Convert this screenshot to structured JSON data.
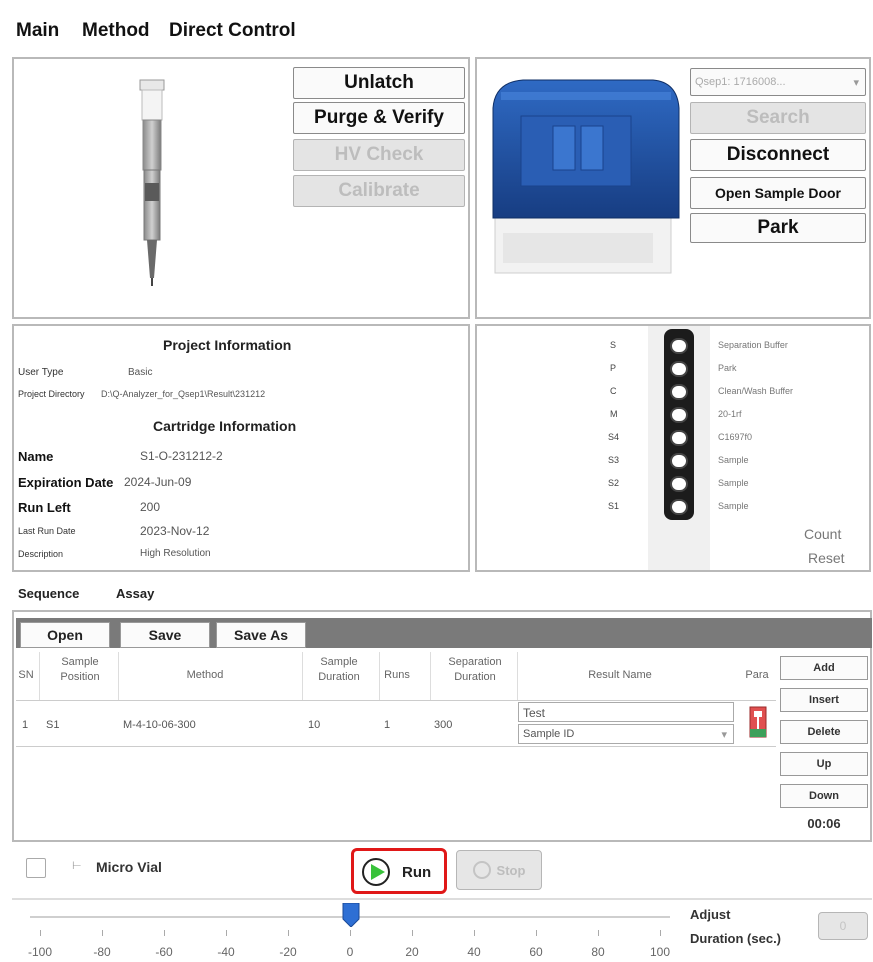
{
  "tabs": {
    "main": "Main",
    "method": "Method",
    "direct_control": "Direct Control"
  },
  "cartridge_controls": {
    "unlatch": "Unlatch",
    "purge_verify": "Purge & Verify",
    "hv_check": "HV Check",
    "calibrate": "Calibrate"
  },
  "instrument_controls": {
    "device_select": "Qsep1: 1716008...",
    "search": "Search",
    "disconnect": "Disconnect",
    "open_sample_door": "Open Sample Door",
    "park": "Park"
  },
  "project_info": {
    "title": "Project Information",
    "user_type_label": "User Type",
    "user_type_value": "Basic",
    "project_directory_label": "Project Directory",
    "project_directory_value": "D:\\Q-Analyzer_for_Qsep1\\Result\\231212"
  },
  "cartridge_info": {
    "title": "Cartridge Information",
    "name_label": "Name",
    "name_value": "S1-O-231212-2",
    "expiration_label": "Expiration Date",
    "expiration_value": "2024-Jun-09",
    "run_left_label": "Run Left",
    "run_left_value": "200",
    "last_run_label": "Last Run Date",
    "last_run_value": "2023-Nov-12",
    "description_label": "Description",
    "description_value": "High Resolution"
  },
  "cartridge_slots": [
    {
      "code": "S",
      "desc": "Separation Buffer"
    },
    {
      "code": "P",
      "desc": "Park"
    },
    {
      "code": "C",
      "desc": "Clean/Wash Buffer"
    },
    {
      "code": "M",
      "desc": "20-1rf"
    },
    {
      "code": "S4",
      "desc": "C1697f0"
    },
    {
      "code": "S3",
      "desc": "Sample"
    },
    {
      "code": "S2",
      "desc": "Sample"
    },
    {
      "code": "S1",
      "desc": "Sample"
    }
  ],
  "count_reset": {
    "line1": "Count",
    "line2": "Reset"
  },
  "sequence_tabs": {
    "sequence": "Sequence",
    "assay": "Assay"
  },
  "toolbar": {
    "open": "Open",
    "save": "Save",
    "save_as": "Save As"
  },
  "table": {
    "headers": {
      "sn": "SN",
      "sample_position": "Sample Position",
      "method": "Method",
      "sample_duration": "Sample Duration",
      "runs": "Runs",
      "separation_duration": "Separation Duration",
      "result_name": "Result Name",
      "para": "Para"
    },
    "rows": [
      {
        "sn": "1",
        "sample_position": "S1",
        "method": "M-4-10-06-300",
        "sample_duration": "10",
        "runs": "1",
        "separation_duration": "300",
        "result_name": "Test",
        "result_type": "Sample ID"
      }
    ]
  },
  "side_buttons": {
    "add": "Add",
    "insert": "Insert",
    "delete": "Delete",
    "up": "Up",
    "down": "Down",
    "timer": "00:06"
  },
  "bottom": {
    "micro_vial": "Micro Vial",
    "run": "Run",
    "stop": "Stop",
    "adjust_line1": "Adjust",
    "adjust_line2": "Duration (sec.)",
    "apply": "0"
  },
  "slider": {
    "ticks": [
      "-100",
      "-80",
      "-60",
      "-40",
      "-20",
      "0",
      "20",
      "40",
      "60",
      "80",
      "100"
    ],
    "value": 0
  },
  "colors": {
    "instrument_blue": "#1e4fa0",
    "run_highlight": "#e01818",
    "run_green": "#38c23a",
    "toolbar_gray": "#7a7a7a",
    "slider_thumb": "#2e6fd4"
  }
}
